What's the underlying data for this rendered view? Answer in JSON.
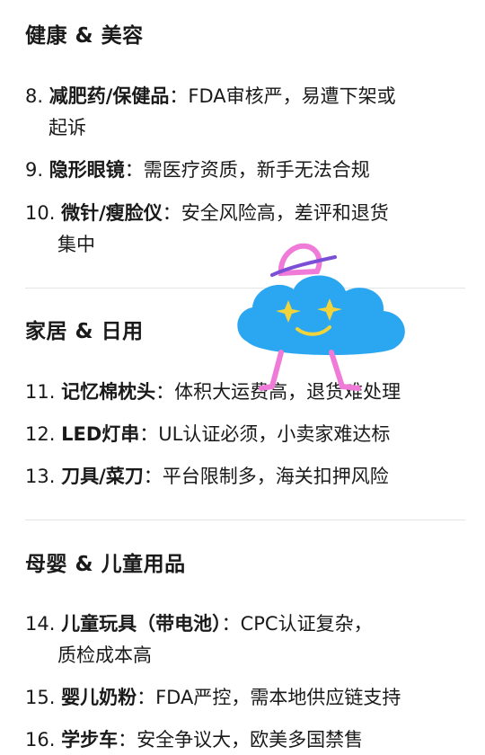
{
  "sections": [
    {
      "title": "健康 & 美容",
      "items": [
        {
          "num": "8.",
          "name": "减肥药/保健品",
          "sep": "：",
          "desc1": "FDA审核严，易遭下架或",
          "desc2": "起诉"
        },
        {
          "num": "9.",
          "name": "隐形眼镜",
          "sep": "：",
          "desc1": "需医疗资质，新手无法合规"
        },
        {
          "num": "10.",
          "name": "微针/瘦脸仪",
          "sep": "：",
          "desc1": "安全风险高，差评和退货",
          "desc2": "集中"
        }
      ]
    },
    {
      "title": "家居 & 日用",
      "items": [
        {
          "num": "11.",
          "name": "记忆棉枕头",
          "sep": "：",
          "desc1": "体积大运费高，退货难处理"
        },
        {
          "num": "12.",
          "name": "LED灯串",
          "sep": "：",
          "desc1": "UL认证必须，小卖家难达标"
        },
        {
          "num": "13.",
          "name": "刀具/菜刀",
          "sep": "：",
          "desc1": "平台限制多，海关扣押风险"
        }
      ]
    },
    {
      "title": "母婴 & 儿童用品",
      "items": [
        {
          "num": "14.",
          "name": "儿童玩具（带电池）",
          "sep": "：",
          "desc1": "CPC认证复杂，",
          "desc2": "质检成本高"
        },
        {
          "num": "15.",
          "name": "婴儿奶粉",
          "sep": "：",
          "desc1": "FDA严控，需本地供应链支持"
        },
        {
          "num": "16.",
          "name": "学步车",
          "sep": "：",
          "desc1": "安全争议大，欧美多国禁售"
        }
      ]
    }
  ],
  "sticker": {
    "icon": "cloud-mascot-icon",
    "colors": {
      "body": "#2aa7f0",
      "accent": "#f07ad8",
      "eyes": "#f2d43a"
    }
  }
}
